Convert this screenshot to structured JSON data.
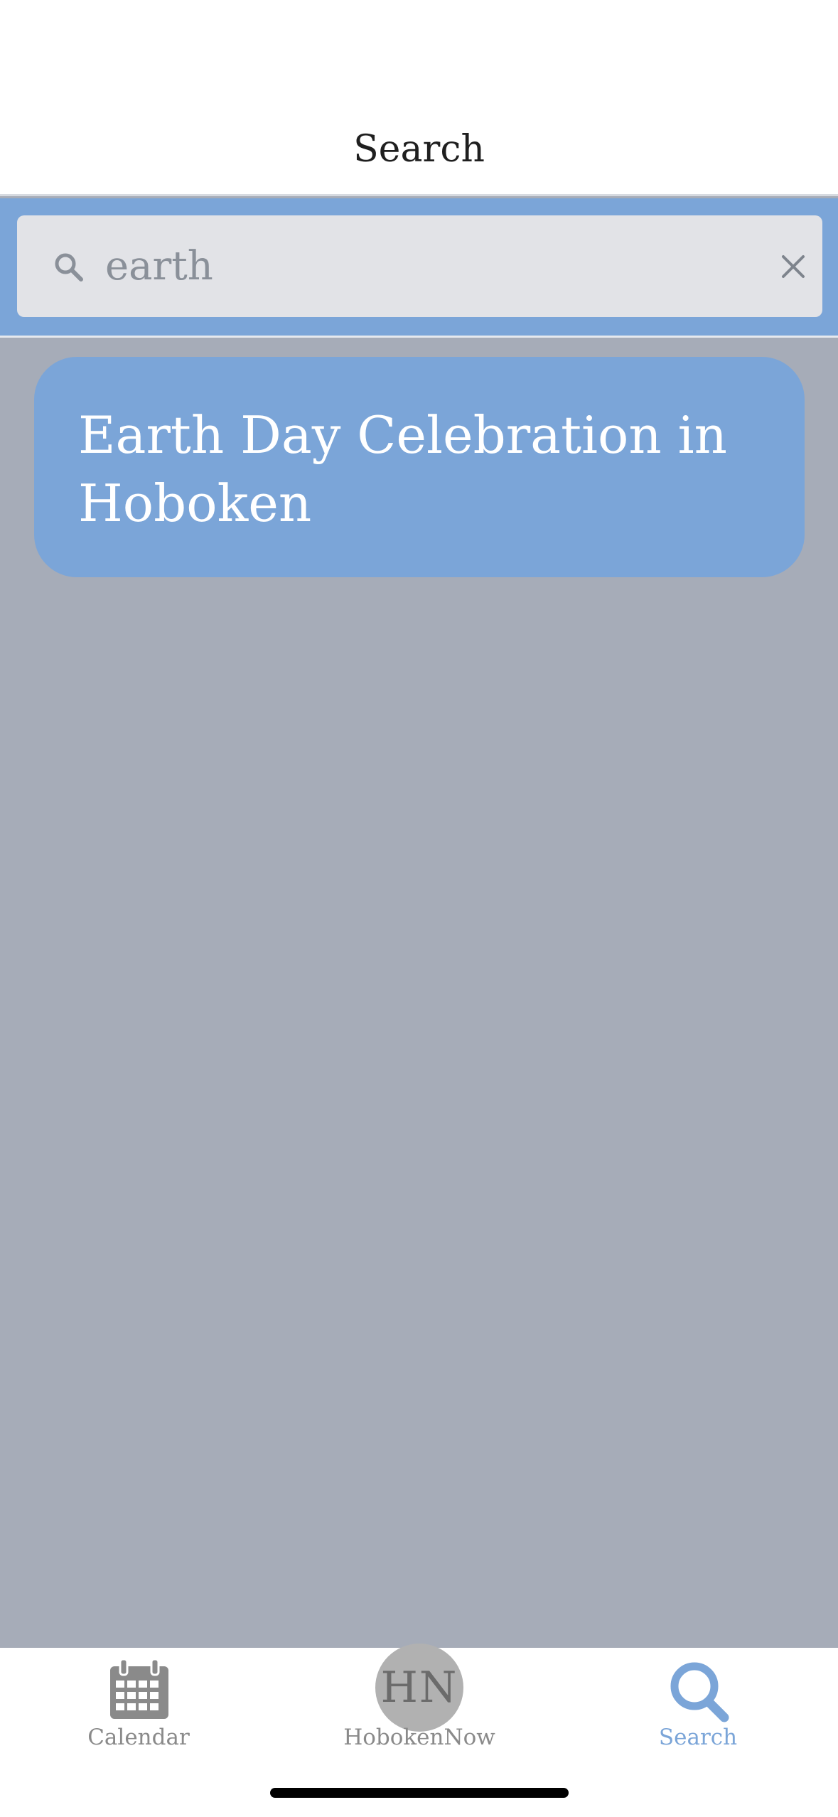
{
  "header": {
    "title": "Search"
  },
  "search": {
    "value": "earth",
    "placeholder": "",
    "search_icon": "search-icon",
    "clear_icon": "close-icon"
  },
  "results": [
    {
      "title": "Earth Day Celebration in Hoboken"
    }
  ],
  "tabbar": {
    "tabs": [
      {
        "label": "Calendar",
        "icon": "calendar-icon",
        "active": false
      },
      {
        "label": "HobokenNow",
        "icon": "hobokennow-logo",
        "logo_text": "HN",
        "active": false
      },
      {
        "label": "Search",
        "icon": "search-icon",
        "active": true
      }
    ]
  },
  "colors": {
    "accent": "#7ba5d8",
    "background": "#a6acb8",
    "search_field": "#e2e3e7",
    "inactive_tab": "#8a8a8a"
  }
}
